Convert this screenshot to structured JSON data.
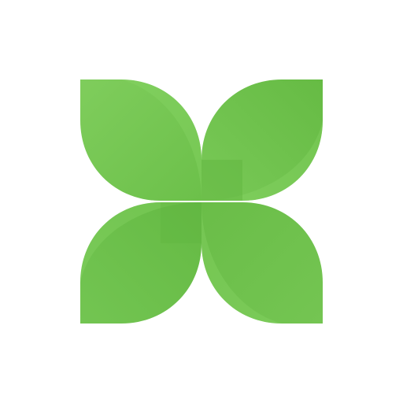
{
  "logo": {
    "icon": "four-leaf-clover-icon",
    "colors": {
      "leaf_light": "#7fcd5c",
      "leaf_mid": "#6cc04a",
      "leaf_dark": "#5fb43f",
      "highlight": "#8ad667",
      "background": "#ffffff"
    }
  }
}
